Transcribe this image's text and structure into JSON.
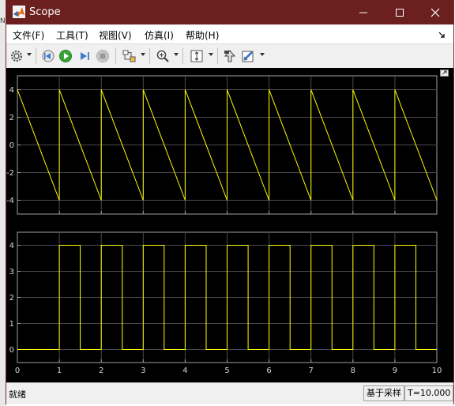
{
  "window": {
    "title": "Scope"
  },
  "menu": [
    {
      "label": "文件(F)"
    },
    {
      "label": "工具(T)"
    },
    {
      "label": "视图(V)"
    },
    {
      "label": "仿真(I)"
    },
    {
      "label": "帮助(H)"
    }
  ],
  "toolbar": {
    "icons": [
      "gear-icon",
      "step-back-icon",
      "run-icon",
      "step-forward-icon",
      "stop-icon",
      "signal-selector-icon",
      "zoom-in-icon",
      "scale-axes-icon",
      "highlight-block-icon",
      "style-icon"
    ]
  },
  "status": {
    "left": "就绪",
    "mode": "基于采样",
    "time": "T=10.000"
  },
  "chart_data": [
    {
      "type": "line",
      "title": "",
      "xlabel": "",
      "ylabel": "",
      "xlim": [
        0,
        10
      ],
      "ylim": [
        -5,
        5
      ],
      "yticks": [
        -4,
        -2,
        0,
        2,
        4
      ],
      "grid": true,
      "line_color": "#ffff00",
      "series": [
        {
          "x": [
            0,
            1,
            1,
            2,
            2,
            3,
            3,
            4,
            4,
            5,
            5,
            6,
            6,
            7,
            7,
            8,
            8,
            9,
            9,
            10
          ],
          "y": [
            4,
            -4,
            4,
            -4,
            4,
            -4,
            4,
            -4,
            4,
            -4,
            4,
            -4,
            4,
            -4,
            4,
            -4,
            4,
            -4,
            4,
            -4
          ]
        }
      ]
    },
    {
      "type": "line",
      "title": "",
      "xlabel": "",
      "ylabel": "",
      "xlim": [
        0,
        10
      ],
      "ylim": [
        -0.5,
        4.5
      ],
      "yticks": [
        0,
        1,
        2,
        3,
        4
      ],
      "xticks": [
        0,
        1,
        2,
        3,
        4,
        5,
        6,
        7,
        8,
        9,
        10
      ],
      "grid": true,
      "line_color": "#ffff00",
      "series": [
        {
          "x": [
            0,
            1,
            1,
            1.5,
            1.5,
            2,
            2,
            2.5,
            2.5,
            3,
            3,
            3.5,
            3.5,
            4,
            4,
            4.5,
            4.5,
            5,
            5,
            5.5,
            5.5,
            6,
            6,
            6.5,
            6.5,
            7,
            7,
            7.5,
            7.5,
            8,
            8,
            8.5,
            8.5,
            9,
            9,
            9.5,
            9.5,
            10
          ],
          "y": [
            0,
            0,
            4,
            4,
            0,
            0,
            4,
            4,
            0,
            0,
            4,
            4,
            0,
            0,
            4,
            4,
            0,
            0,
            4,
            4,
            0,
            0,
            4,
            4,
            0,
            0,
            4,
            4,
            0,
            0,
            4,
            4,
            0,
            0,
            4,
            4,
            0,
            0
          ]
        }
      ]
    }
  ]
}
